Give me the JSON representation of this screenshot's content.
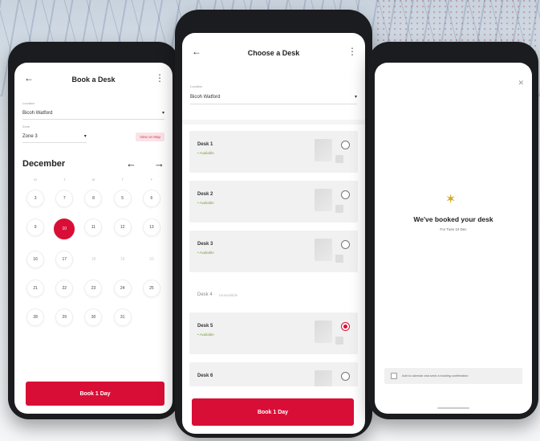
{
  "screen1": {
    "title": "Book a Desk",
    "building_label": "Location",
    "building_value": "Bicoh Watford",
    "zone_label": "Zone",
    "zone_value": "Zone 3",
    "badge": "View on Map",
    "month": "December",
    "weekdays": [
      "M",
      "T",
      "W",
      "T",
      "F"
    ],
    "days": [
      {
        "label": "3",
        "state": "normal"
      },
      {
        "label": "7",
        "state": "normal"
      },
      {
        "label": "8",
        "state": "normal"
      },
      {
        "label": "5",
        "state": "normal"
      },
      {
        "label": "6",
        "state": "normal"
      },
      {
        "label": "9",
        "state": "normal"
      },
      {
        "label": "10",
        "state": "selected"
      },
      {
        "label": "11",
        "state": "normal"
      },
      {
        "label": "12",
        "state": "normal"
      },
      {
        "label": "13",
        "state": "normal"
      },
      {
        "label": "16",
        "state": "normal"
      },
      {
        "label": "17",
        "state": "normal"
      },
      {
        "label": "18",
        "state": "dim"
      },
      {
        "label": "19",
        "state": "dim"
      },
      {
        "label": "20",
        "state": "dim"
      },
      {
        "label": "21",
        "state": "normal"
      },
      {
        "label": "22",
        "state": "normal"
      },
      {
        "label": "23",
        "state": "normal"
      },
      {
        "label": "24",
        "state": "normal"
      },
      {
        "label": "25",
        "state": "normal"
      },
      {
        "label": "28",
        "state": "normal"
      },
      {
        "label": "29",
        "state": "normal"
      },
      {
        "label": "30",
        "state": "normal"
      },
      {
        "label": "31",
        "state": "normal"
      }
    ],
    "cta": "Book 1 Day"
  },
  "screen2": {
    "title": "Choose a Desk",
    "building_label": "Location",
    "building_value": "Bicoh Watford",
    "desks": [
      {
        "name": "Desk 1",
        "status": "• Available",
        "selected": false,
        "available": true
      },
      {
        "name": "Desk 2",
        "status": "• Available",
        "selected": false,
        "available": true
      },
      {
        "name": "Desk 3",
        "status": "• Available",
        "selected": false,
        "available": true
      },
      {
        "name": "Desk 4",
        "status": "Unavailable",
        "selected": false,
        "available": false
      },
      {
        "name": "Desk 5",
        "status": "• Available",
        "selected": true,
        "available": true
      },
      {
        "name": "Desk 6",
        "status": "",
        "selected": false,
        "available": true
      }
    ],
    "cta": "Book 1 Day"
  },
  "screen3": {
    "title": "We've booked your desk",
    "subtitle": "For Tues 10 Dec",
    "option": "Add to calendar and send a booking confirmation"
  },
  "icons": {
    "back": "arrow-left-icon",
    "menu": "more-vertical-icon",
    "close": "close-icon",
    "celebrate": "party-popper-icon"
  },
  "colors": {
    "accent": "#d90e36",
    "available": "#7aa33a"
  }
}
